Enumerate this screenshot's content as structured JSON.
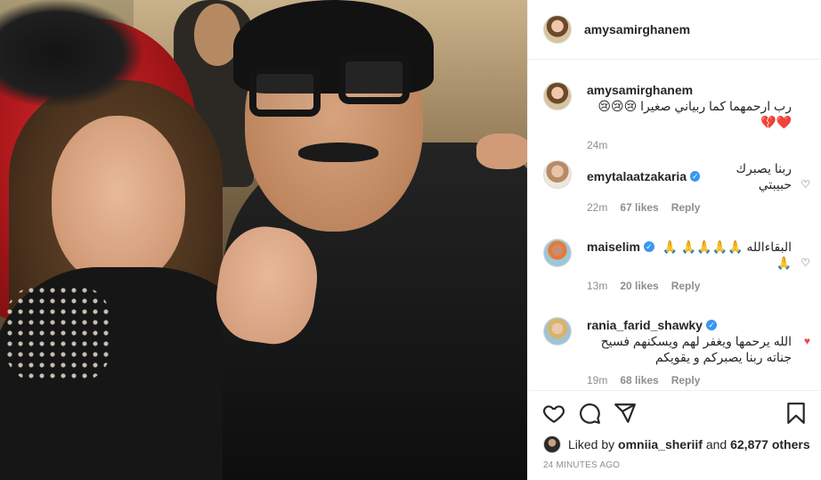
{
  "post": {
    "username": "amysamirghanem",
    "caption_username": "amysamirghanem",
    "caption_text": "رب ارحمهما كما ربياني صغيرا 😢😢😢❤️💔",
    "caption_time": "24m"
  },
  "comments": [
    {
      "username": "emytalaatzakaria",
      "verified": true,
      "text": "ربنا يصبرك حبيبتي",
      "time": "22m",
      "likes": "67 likes",
      "reply": "Reply",
      "liked": false
    },
    {
      "username": "maiselim",
      "verified": true,
      "text": "البقاءالله 🙏🙏🙏🙏 🙏🙏",
      "time": "13m",
      "likes": "20 likes",
      "reply": "Reply",
      "liked": false
    },
    {
      "username": "rania_farid_shawky",
      "verified": true,
      "text": "الله يرحمها ويغفر لهم ويسكنهم فسيح جناته ربنا يصبركم و يقويكم",
      "time": "19m",
      "likes": "68 likes",
      "reply": "Reply",
      "liked": true
    }
  ],
  "likes": {
    "prefix": "Liked by",
    "user": "omniia_sheriif",
    "and": "and",
    "others": "62,877 others"
  },
  "timestamp": "24 MINUTES AGO",
  "icons": [
    "heart-icon",
    "comment-icon",
    "share-icon",
    "bookmark-icon"
  ],
  "colors": {
    "verified": "#3897f0",
    "liked_heart": "#ed4956",
    "muted": "#8e8e8e"
  }
}
